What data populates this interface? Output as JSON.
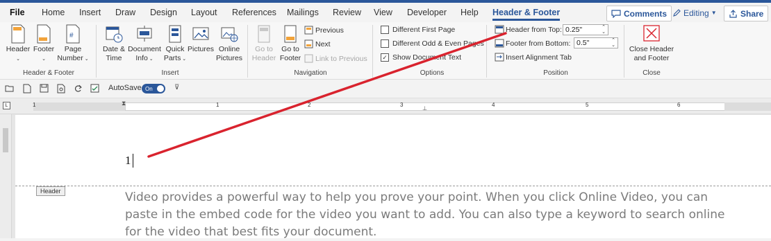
{
  "tabs": [
    {
      "label": "File"
    },
    {
      "label": "Home"
    },
    {
      "label": "Insert"
    },
    {
      "label": "Draw"
    },
    {
      "label": "Design"
    },
    {
      "label": "Layout"
    },
    {
      "label": "References"
    },
    {
      "label": "Mailings"
    },
    {
      "label": "Review"
    },
    {
      "label": "View"
    },
    {
      "label": "Developer"
    },
    {
      "label": "Help"
    },
    {
      "label": "Header & Footer"
    }
  ],
  "right_buttons": {
    "comments": "Comments",
    "editing": "Editing",
    "share": "Share"
  },
  "ribbon": {
    "group_header_footer": {
      "header": "Header",
      "footer": "Footer",
      "page": "Page",
      "number": "Number",
      "label": "Header & Footer"
    },
    "group_insert": {
      "date1": "Date &",
      "date2": "Time",
      "doc1": "Document",
      "doc2": "Info",
      "quick1": "Quick",
      "quick2": "Parts",
      "pictures": "Pictures",
      "online1": "Online",
      "online2": "Pictures",
      "label": "Insert"
    },
    "group_navigation": {
      "goto_header1": "Go to",
      "goto_header2": "Header",
      "goto_footer1": "Go to",
      "goto_footer2": "Footer",
      "previous": "Previous",
      "next": "Next",
      "link": "Link to Previous",
      "label": "Navigation"
    },
    "group_options": {
      "first": "Different First Page",
      "oddeven": "Different Odd & Even Pages",
      "show_text": "Show Document Text",
      "label": "Options"
    },
    "group_position": {
      "header_top": "Header from Top:",
      "header_top_value": "0.25\"",
      "footer_bottom": "Footer from Bottom:",
      "footer_bottom_value": "0.5\"",
      "align_tab": "Insert Alignment Tab",
      "label": "Position"
    },
    "group_close": {
      "close1": "Close Header",
      "close2": "and Footer",
      "label": "Close"
    }
  },
  "qat": {
    "autosave": "AutoSave",
    "toggle": "On"
  },
  "ruler_numbers": [
    "1",
    "1",
    "2",
    "3",
    "4",
    "5",
    "6"
  ],
  "document": {
    "header_tag": "Header",
    "page_number": "1",
    "body": "Video provides a powerful way to help you prove your point. When you click Online Video, you can paste in the embed code for the video you want to add. You can also type a keyword to search online for the video that best fits your document."
  },
  "colors": {
    "accent": "#2b579a",
    "annotation": "#d9232e"
  }
}
